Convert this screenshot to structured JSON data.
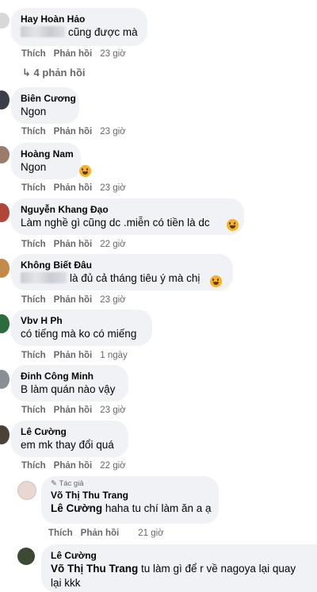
{
  "actions": {
    "like": "Thích",
    "reply": "Phản hồi"
  },
  "comments": [
    {
      "name": "Hay Hoàn Hảo",
      "text": "cũng được mà",
      "time": "23 giờ"
    },
    {
      "name": "Biên Cương",
      "text": "Ngon",
      "time": "23 giờ"
    },
    {
      "name": "Hoàng Nam",
      "text": "Ngon",
      "time": "23 giờ"
    },
    {
      "name": "Nguyễn Khang Đạo",
      "text": "Làm nghề gì cũng dc .miễn có tiền là dc",
      "time": "22 giờ"
    },
    {
      "name": "Không Biết Đâu",
      "text": "là đủ cả tháng tiêu ý mà chị",
      "time": "23 giờ"
    },
    {
      "name": "Vbv H Ph",
      "text": "có tiếng mà ko có miếng",
      "time": "1 ngày"
    },
    {
      "name": "Đinh Công Minh",
      "text": "B làm quán nào vậy",
      "time": "23 giờ"
    },
    {
      "name": "Lê Cường",
      "text": "em mk thay đổi quá",
      "time": "22 giờ"
    }
  ],
  "view_replies": "4 phản hồi",
  "nested": [
    {
      "author_tag": "Tác giả",
      "name": "Võ Thị Thu Trang",
      "mention": "Lê Cường",
      "text": "haha tu chí làm ăn a ạ",
      "time": "21 giờ"
    },
    {
      "name": "Lê Cường",
      "mention": "Võ Thị Thu Trang",
      "text": "tu làm gì để r về nagoya lại quay",
      "text2": "lại kkk"
    }
  ],
  "colors": {
    "bubble": "#f0f2f5",
    "meta": "#65676b",
    "text": "#050505"
  }
}
